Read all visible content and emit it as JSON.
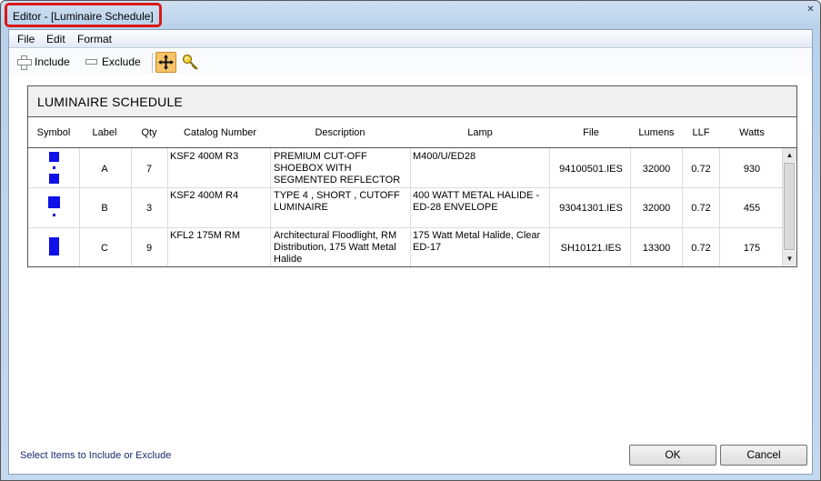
{
  "window": {
    "title": "Editor - [Luminaire Schedule]",
    "close_glyph": "✕"
  },
  "menu": {
    "items": [
      "File",
      "Edit",
      "Format"
    ]
  },
  "toolbar": {
    "include_label": "Include",
    "exclude_label": "Exclude"
  },
  "schedule": {
    "title": "LUMINAIRE SCHEDULE",
    "columns": [
      "Symbol",
      "Label",
      "Qty",
      "Catalog Number",
      "Description",
      "Lamp",
      "File",
      "Lumens",
      "LLF",
      "Watts"
    ],
    "rows": [
      {
        "symbol": "symbol-ksf2-r3-icon",
        "label": "A",
        "qty": "7",
        "catalog": "KSF2 400M R3",
        "description": [
          "PREMIUM CUT-OFF",
          "SHOEBOX WITH",
          "SEGMENTED REFLECTOR"
        ],
        "lamp": [
          "M400/U/ED28"
        ],
        "file": "94100501.IES",
        "lumens": "32000",
        "llf": "0.72",
        "watts": "930"
      },
      {
        "symbol": "symbol-ksf2-r4-icon",
        "label": "B",
        "qty": "3",
        "catalog": "KSF2 400M R4",
        "description": [
          "TYPE 4 , SHORT , CUTOFF",
          "LUMINAIRE"
        ],
        "lamp": [
          "400 WATT METAL HALIDE -",
          "ED-28 ENVELOPE"
        ],
        "file": "93041301.IES",
        "lumens": "32000",
        "llf": "0.72",
        "watts": "455"
      },
      {
        "symbol": "symbol-kfl2-icon",
        "label": "C",
        "qty": "9",
        "catalog": "KFL2 175M RM",
        "description": [
          "Architectural Floodlight, RM",
          "Distribution, 175 Watt Metal",
          "Halide"
        ],
        "lamp": [
          "175 Watt Metal Halide, Clear",
          "ED-17"
        ],
        "file": "SH10121.IES",
        "lumens": "13300",
        "llf": "0.72",
        "watts": "175"
      }
    ]
  },
  "status_text": "Select Items to Include or Exclude",
  "buttons": {
    "ok": "OK",
    "cancel": "Cancel"
  },
  "colors": {
    "symbol": "#1010e8",
    "title_highlight": "#d81818"
  }
}
